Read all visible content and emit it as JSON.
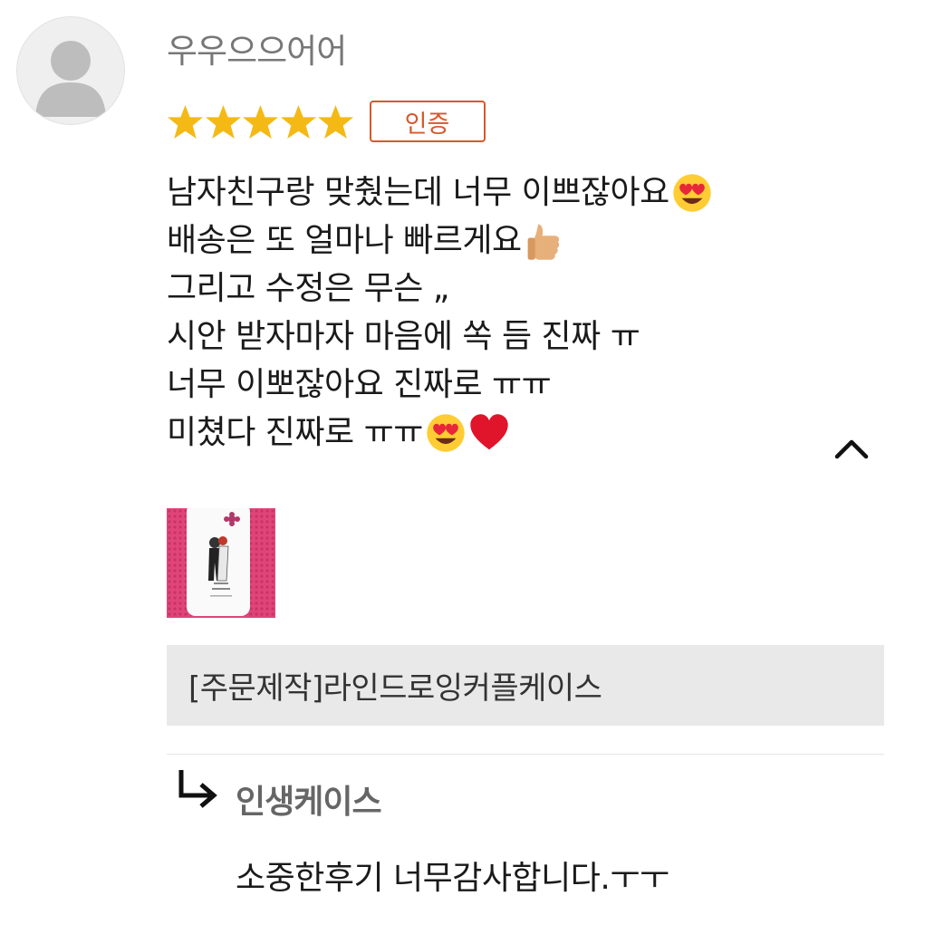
{
  "review": {
    "username": "우우으으어어",
    "rating": 5,
    "max_rating": 5,
    "verified_badge": "인증",
    "lines": [
      {
        "text": "남자친구랑 맞췄는데 너무 이쁘잖아요",
        "emojis": [
          "heart-eyes-emoji"
        ]
      },
      {
        "text": "배송은 또 얼마나 빠르게요",
        "emojis": [
          "thumbs-up-emoji"
        ]
      },
      {
        "text": "그리고 수정은 무슨 „",
        "emojis": []
      },
      {
        "text": "시안 받자마자 마음에 쏙 듬 진짜 ㅠ",
        "emojis": []
      },
      {
        "text": "너무 이뽀잖아요 진짜로 ㅠㅠ",
        "emojis": []
      },
      {
        "text": "미쳤다 진짜로 ㅠㅠ",
        "emojis": [
          "heart-eyes-emoji",
          "red-heart-emoji"
        ]
      }
    ],
    "collapse_icon": "chevron-up-icon",
    "product_name": "[주문제작]라인드로잉커플케이스"
  },
  "reply": {
    "icon": "reply-arrow-icon",
    "author": "인생케이스",
    "text": "소중한후기 너무감사합니다.ㅜㅜ"
  },
  "colors": {
    "star": "#f5b916",
    "badge": "#d6592a",
    "product_bar_bg": "#e9e9e9",
    "thumbnail_bg": "#e0457a"
  }
}
